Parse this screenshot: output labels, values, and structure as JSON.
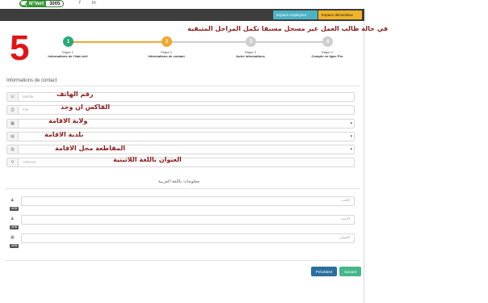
{
  "topbar": {
    "badge_icon": "☎",
    "badge_label": "N°Vert",
    "badge_number": "3005",
    "social_f": "f",
    "social_in": "in"
  },
  "header": {
    "btn_employer": "Espace employeur",
    "btn_demandeur": "Espace demandeur"
  },
  "annotation": {
    "step_number": "5",
    "note_top": "في حالة طالب العمل غير مسجل مسبقا تكمل المراحل المتبقية",
    "label_phone": "رقم الهاتف",
    "label_fax": "الفاكس ان وجد",
    "label_wilaya": "ولاية الاقامة",
    "label_commune": "بلدية الاقامة",
    "label_daira": "المقاطعة محل الاقامة",
    "label_address": "العنوان باللغة اللاتينية"
  },
  "stepper": {
    "steps": [
      {
        "num": "1",
        "title": "Etape 1",
        "subtitle": "Informations de l'état civil",
        "state": "done"
      },
      {
        "num": "2",
        "title": "Etape 2",
        "subtitle": "Informations de contact",
        "state": "active"
      },
      {
        "num": "3",
        "title": "Etape 3",
        "subtitle": "Autre informations",
        "state": "todo"
      },
      {
        "num": "4",
        "title": "Etape 4",
        "subtitle": "Compte en ligne Pro",
        "state": "todo"
      }
    ],
    "colors": {
      "done": "#2aa876",
      "active": "#f0a830",
      "todo": "#cfcfcf"
    }
  },
  "form": {
    "section_title": "Informations de contact",
    "fields": [
      {
        "icon": "☏",
        "icon_name": "phone-icon",
        "placeholder": "Mobile"
      },
      {
        "icon": "⎙",
        "icon_name": "fax-icon",
        "placeholder": "Fax"
      },
      {
        "icon": "▦",
        "icon_name": "building-icon",
        "placeholder": ""
      },
      {
        "icon": "▤",
        "icon_name": "building-icon",
        "placeholder": ""
      },
      {
        "icon": "▥",
        "icon_name": "building-icon",
        "placeholder": ""
      },
      {
        "icon": "⚲",
        "icon_name": "map-marker-icon",
        "placeholder": "Adresse"
      }
    ]
  },
  "arabic_section": {
    "title": "معلومات باللغة العربية",
    "fields": [
      {
        "icon": "♟",
        "icon_name": "user-icon",
        "placeholder": "اللقب",
        "tag": "ARB"
      },
      {
        "icon": "♟",
        "icon_name": "user-icon",
        "placeholder": "الإسم",
        "tag": "ARB"
      },
      {
        "icon": "▦",
        "icon_name": "home-icon",
        "placeholder": "العنوان",
        "tag": "ARB"
      }
    ]
  },
  "nav": {
    "prev": "Précédent",
    "next": "Suivant"
  }
}
